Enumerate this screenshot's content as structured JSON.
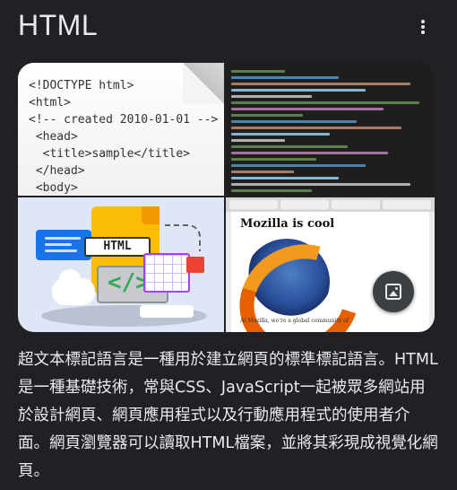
{
  "header": {
    "title": "HTML",
    "more_icon": "more-vert-icon"
  },
  "images": {
    "tile1_code": "<!DOCTYPE html>\n<html>\n<!-- created 2010-01-01 -->\n <head>\n  <title>sample</title>\n </head>\n <body>",
    "tile3_tag": "HTML",
    "tile3_code": "</>",
    "tile4_heading": "Mozilla is cool",
    "tile4_caption": "At Mozilla, we're a global community of",
    "more_images_icon": "image-icon"
  },
  "description": "超文本標記語言是一種用於建立網頁的標準標記語言。HTML是一種基礎技術，常與CSS、JavaScript一起被眾多網站用於設計網頁、網頁應用程式以及行動應用程式的使用者介面。網頁瀏覽器可以讀取HTML檔案，並將其彩現成視覺化網頁。",
  "colors": {
    "background": "#202124",
    "text": "#e8eaed",
    "html_yellow": "#fbbc04",
    "accent_blue": "#1a73e8"
  }
}
